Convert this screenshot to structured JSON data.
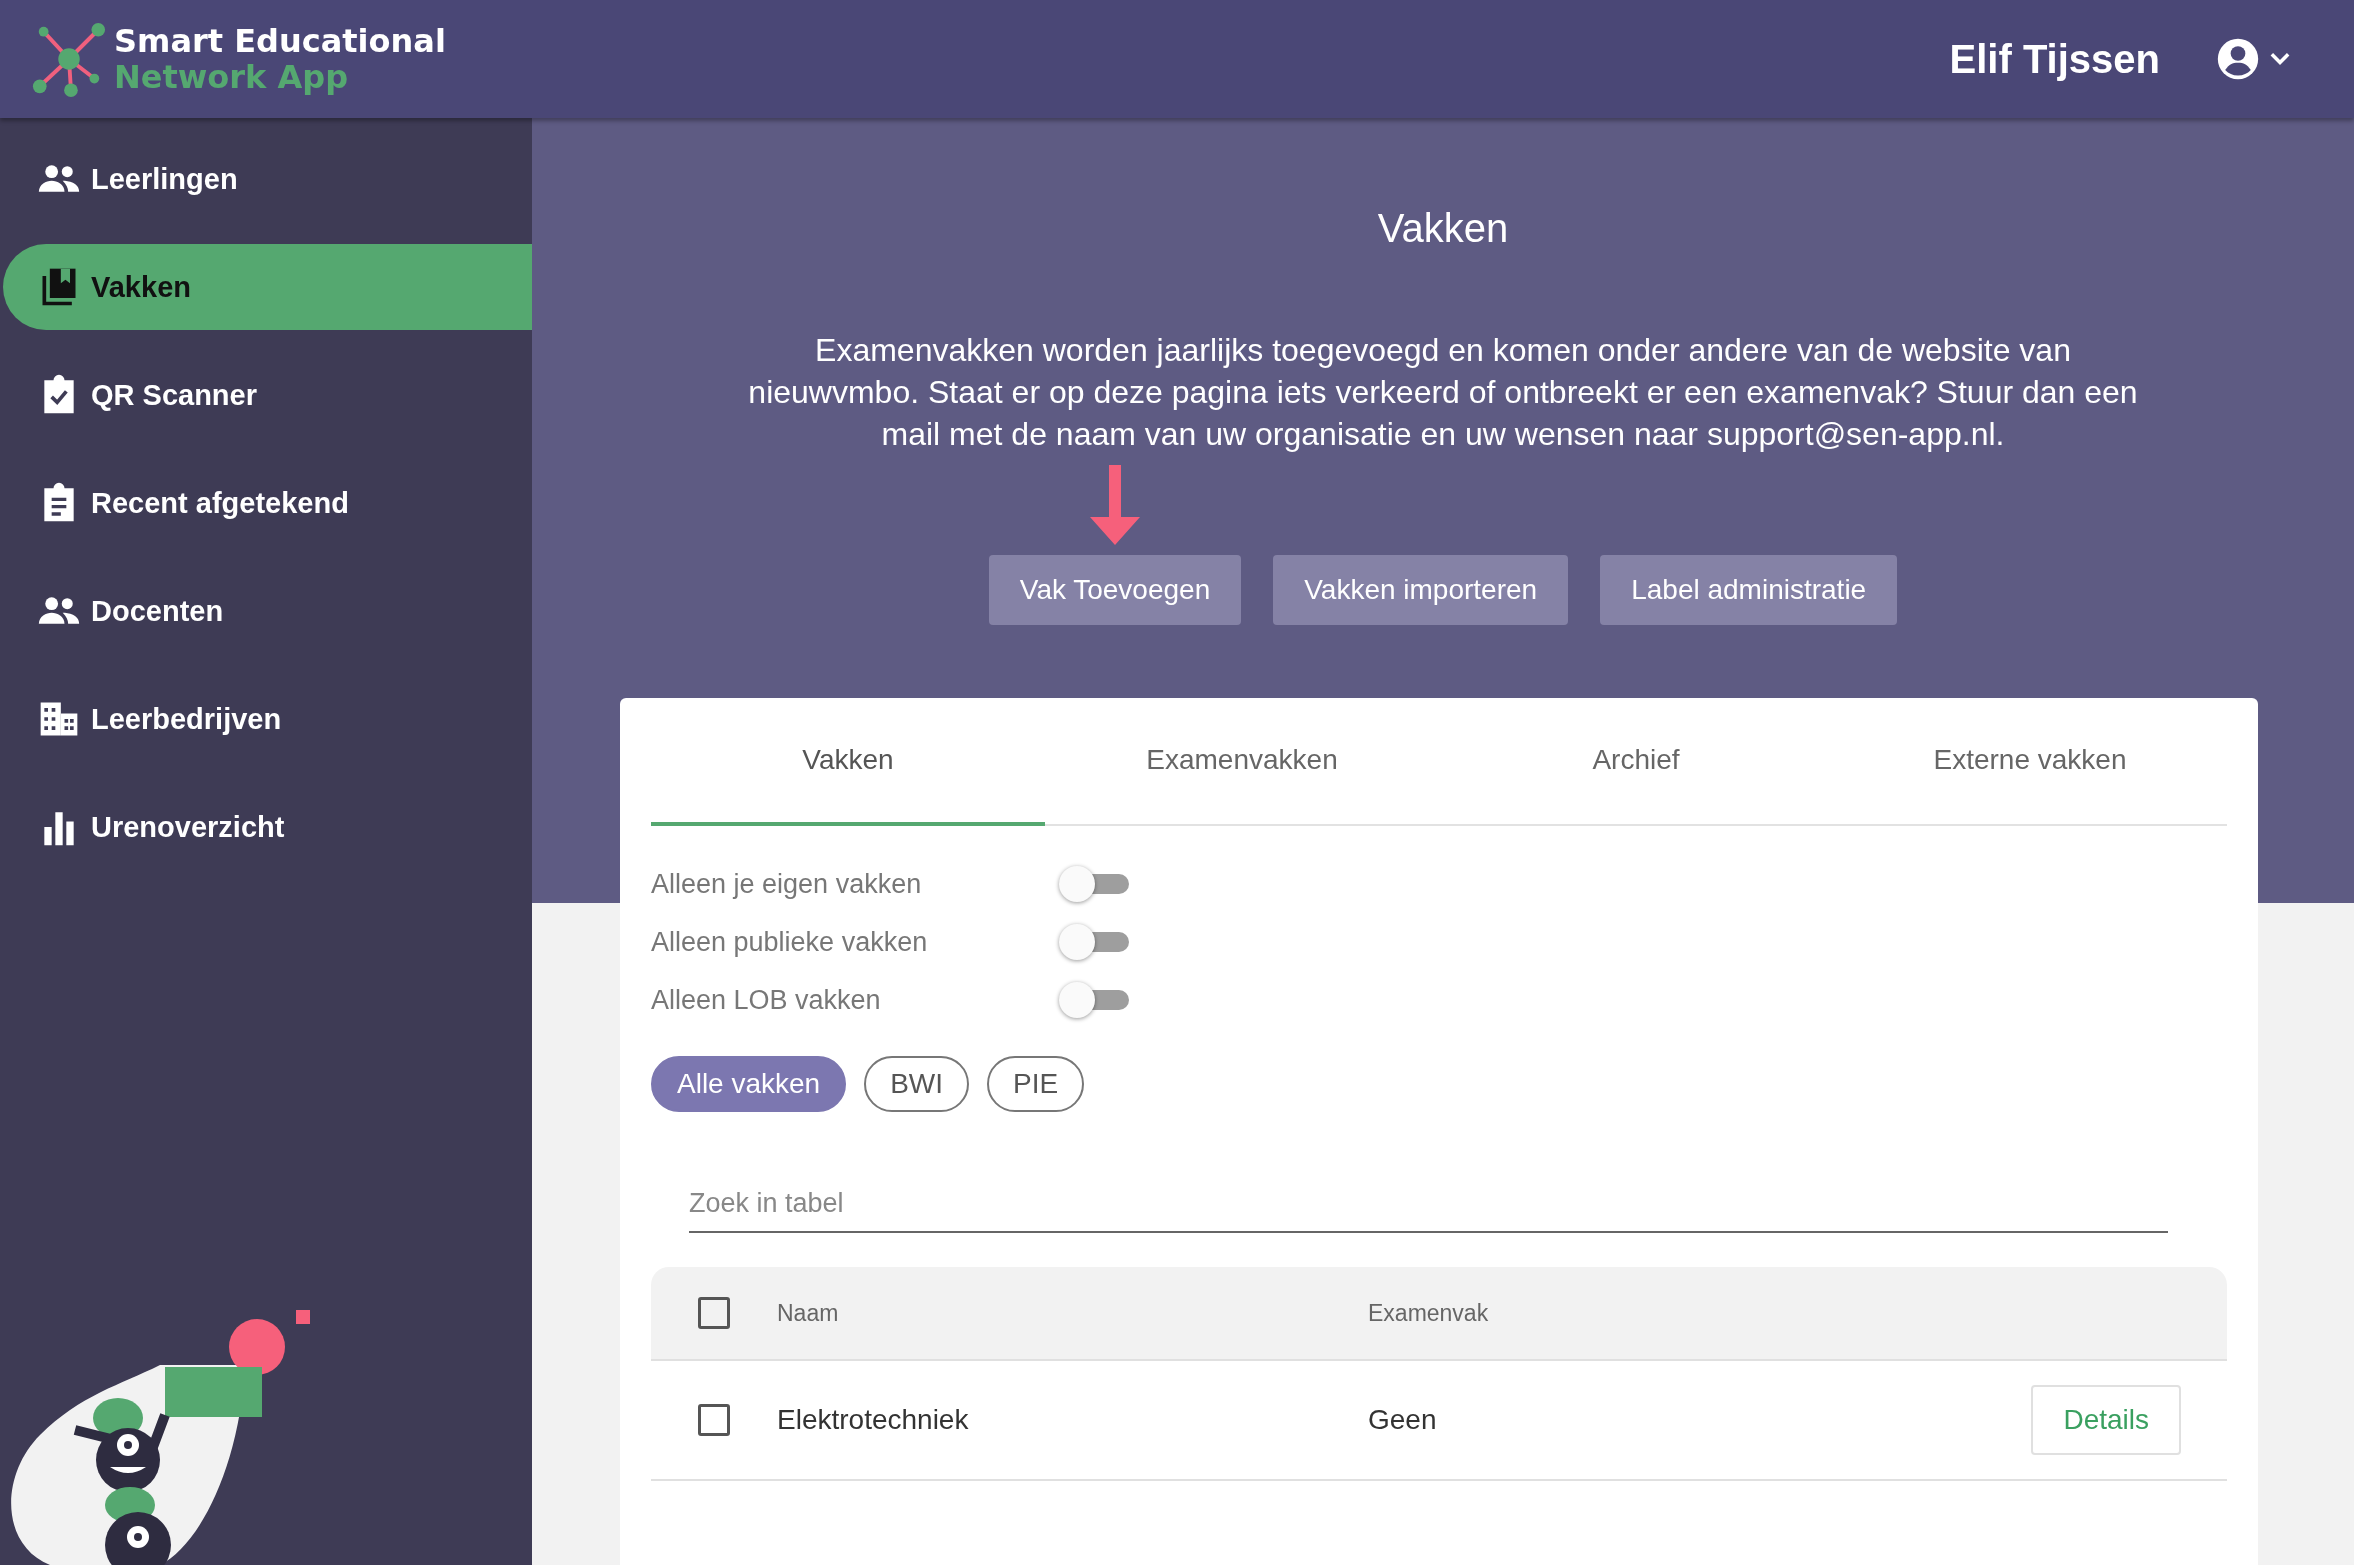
{
  "header": {
    "logo_line_1": "Smart Educational",
    "logo_line_2": "Network App",
    "user_name": "Elif Tijssen"
  },
  "sidebar": {
    "items": [
      {
        "label": "Leerlingen",
        "kind": "people",
        "selected": false
      },
      {
        "label": "Vakken",
        "kind": "books",
        "selected": true
      },
      {
        "label": "QR Scanner",
        "kind": "clipboard-check",
        "selected": false
      },
      {
        "label": "Recent afgetekend",
        "kind": "clipboard-list",
        "selected": false
      },
      {
        "label": "Docenten",
        "kind": "people",
        "selected": false
      },
      {
        "label": "Leerbedrijven",
        "kind": "building",
        "selected": false
      },
      {
        "label": "Urenoverzicht",
        "kind": "chart",
        "selected": false
      }
    ]
  },
  "page": {
    "title": "Vakken",
    "description": "Examenvakken worden jaarlijks toegevoegd en komen onder andere van de website van nieuwvmbo. Staat er op deze pagina iets verkeerd of ontbreekt er een examenvak? Stuur dan een mail met de naam van uw organisatie en uw wensen naar support@sen-app.nl.",
    "buttons": [
      "Vak Toevoegen",
      "Vakken importeren",
      "Label administratie"
    ]
  },
  "tabs": [
    {
      "label": "Vakken",
      "selected": true
    },
    {
      "label": "Examenvakken",
      "selected": false
    },
    {
      "label": "Archief",
      "selected": false
    },
    {
      "label": "Externe vakken",
      "selected": false
    }
  ],
  "toggles": [
    {
      "label": "Alleen je eigen vakken",
      "on": false
    },
    {
      "label": "Alleen publieke vakken",
      "on": false
    },
    {
      "label": "Alleen LOB vakken",
      "on": false
    }
  ],
  "chips": [
    {
      "label": "Alle vakken",
      "selected": true
    },
    {
      "label": "BWI",
      "selected": false
    },
    {
      "label": "PIE",
      "selected": false
    }
  ],
  "search": {
    "placeholder": "Zoek in tabel"
  },
  "table": {
    "select_all_checked": false,
    "columns": [
      "Naam",
      "Examenvak"
    ],
    "rows": [
      {
        "checked": false,
        "naam": "Elektrotechniek",
        "examenvak": "Geen",
        "action": "Details"
      }
    ]
  }
}
